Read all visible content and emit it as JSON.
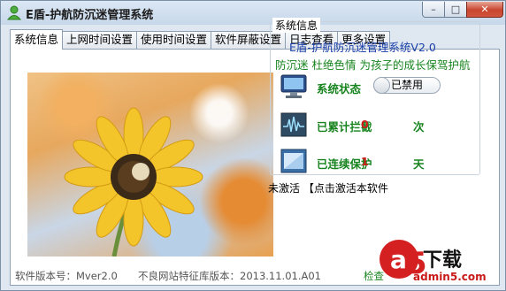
{
  "window": {
    "title": "E盾-护航防沉迷管理系统",
    "minimize_glyph": "–",
    "maximize_glyph": "□",
    "close_glyph": "✕"
  },
  "tabs": [
    {
      "label": "系统信息",
      "active": true
    },
    {
      "label": "上网时间设置"
    },
    {
      "label": "使用时间设置"
    },
    {
      "label": "软件屏蔽设置"
    },
    {
      "label": "日志查看"
    },
    {
      "label": "更多设置"
    }
  ],
  "info": {
    "caption": "系统信息",
    "product_title": "E盾-护航防沉迷管理系统V2.0",
    "slogan": "防沉迷 杜绝色情 为孩子的成长保驾护航",
    "status_label": "系统状态",
    "status_toggle": "已禁用",
    "blocked_label": "已累计拦截",
    "blocked_count": "0",
    "blocked_unit": "次",
    "protect_label": "已连续保护",
    "protect_days": "1",
    "protect_unit": "天"
  },
  "activation": {
    "state": "未激活",
    "link": "【点击激活本软件"
  },
  "statusbar": {
    "version": "软件版本号：Mver2.0",
    "signature": "不良网站特征库版本：2013.11.01.A01",
    "check_update": "检查"
  },
  "watermark": {
    "logo_text": "下载",
    "site": "admin5.com"
  },
  "icons": {
    "app": "green-user-icon",
    "status": "monitor-icon",
    "blocked": "waveform-chart-icon",
    "protect": "window-screen-icon"
  }
}
